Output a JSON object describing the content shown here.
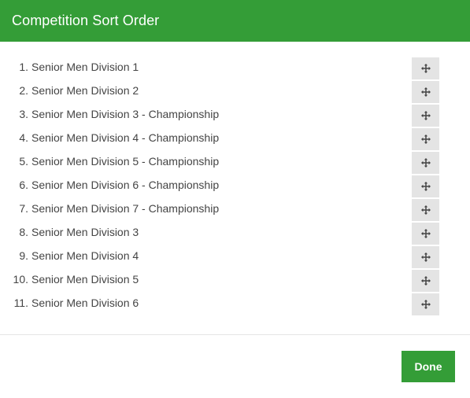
{
  "dialog": {
    "title": "Competition Sort Order",
    "done_label": "Done",
    "accent_color": "#349d37",
    "handle_icon": "move-arrows-icon"
  },
  "competitions": [
    {
      "index": "1.",
      "name": "Senior Men Division 1"
    },
    {
      "index": "2.",
      "name": "Senior Men Division 2"
    },
    {
      "index": "3.",
      "name": "Senior Men Division 3 - Championship"
    },
    {
      "index": "4.",
      "name": "Senior Men Division 4 - Championship"
    },
    {
      "index": "5.",
      "name": "Senior Men Division 5 - Championship"
    },
    {
      "index": "6.",
      "name": "Senior Men Division 6 - Championship"
    },
    {
      "index": "7.",
      "name": "Senior Men Division 7 - Championship"
    },
    {
      "index": "8.",
      "name": "Senior Men Division 3"
    },
    {
      "index": "9.",
      "name": "Senior Men Division 4"
    },
    {
      "index": "10.",
      "name": "Senior Men Division 5"
    },
    {
      "index": "11.",
      "name": "Senior Men Division 6"
    }
  ]
}
